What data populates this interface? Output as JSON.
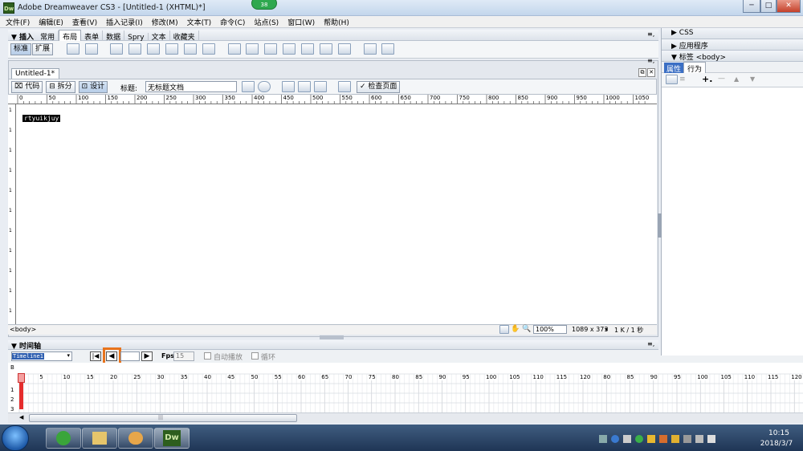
{
  "window": {
    "app_icon_text": "Dw",
    "title": "Adobe Dreamweaver CS3 - [Untitled-1 (XHTML)*]",
    "badge": "38",
    "btn_min": "─",
    "btn_max": "□",
    "btn_close": "✕"
  },
  "menu": [
    "文件(F)",
    "编辑(E)",
    "查看(V)",
    "插入记录(I)",
    "修改(M)",
    "文本(T)",
    "命令(C)",
    "站点(S)",
    "窗口(W)",
    "帮助(H)"
  ],
  "insert_panel": {
    "header": "▼ 插入",
    "tabs": [
      "常用",
      "布局",
      "表单",
      "数据",
      "Spry",
      "文本",
      "收藏夹"
    ],
    "selected_tab": "布局",
    "mode_buttons": [
      "标准",
      "扩展"
    ],
    "menu_icon": "≡,"
  },
  "document": {
    "tab_label": "Untitled-1*",
    "view_buttons": [
      "代码",
      "拆分",
      "设计"
    ],
    "title_label": "标题:",
    "title_value": "无标题文档",
    "check_page": "检查页面",
    "content_text": "rtyuikjuy",
    "status_tag": "<body>",
    "zoom": "100%",
    "size_info": "1089 x 373",
    "size_arrow": "▾",
    "download_info": "1 K / 1 秒"
  },
  "ruler_h_labels": [
    "0",
    "50",
    "100",
    "150",
    "200",
    "250",
    "300",
    "350",
    "400",
    "450",
    "500",
    "550",
    "600",
    "650",
    "700",
    "750",
    "800",
    "850",
    "900",
    "950",
    "1000",
    "1050"
  ],
  "ruler_v_labels": [
    "1",
    "1",
    "1",
    "1",
    "1",
    "1",
    "1",
    "1",
    "1",
    "1",
    "1"
  ],
  "timeline": {
    "header": "▼ 时间轴",
    "selector": "Timeline1",
    "fps_label": "Fps",
    "fps_value": "15",
    "autoplay": "自动播放",
    "loop": "循环",
    "frame_labels": [
      "1",
      "5",
      "10",
      "15",
      "20",
      "25",
      "30",
      "35",
      "40",
      "45",
      "50",
      "55",
      "60",
      "65",
      "70",
      "75",
      "80",
      "85",
      "90",
      "95",
      "100",
      "105",
      "110",
      "115",
      "120",
      "80",
      "85",
      "90",
      "95",
      "100",
      "105",
      "110",
      "115",
      "120"
    ],
    "row_labels": [
      "B",
      "1",
      "2",
      "3"
    ],
    "scroll_grip": "|||"
  },
  "right_panel": {
    "css": "▶ CSS",
    "app": "▶ 应用程序",
    "tag": "▼ 标签 <body>",
    "tabs": [
      "属性",
      "行为"
    ],
    "selected_tab": "行为",
    "add": "+.",
    "remove": "—",
    "up": "▲",
    "down": "▼"
  },
  "taskbar": {
    "dw_label": "Dw",
    "time": "10:15",
    "date": "2018/3/7"
  },
  "colors": {
    "highlight": "#e8731c",
    "titlebar": "#c3d6ec",
    "selection": "#000000"
  }
}
